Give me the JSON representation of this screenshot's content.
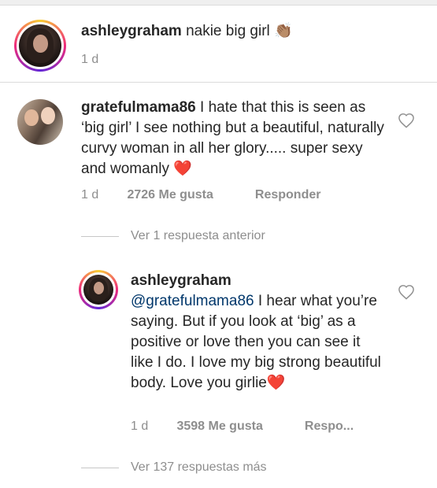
{
  "caption": {
    "username": "ashleygraham",
    "text": "nakie big girl",
    "emoji": "👏🏽",
    "time": "1 d"
  },
  "comment1": {
    "username": "gratefulmama86",
    "text": "I hate that this is seen as ‘big girl’ I see nothing but a beautiful, naturally curvy woman in all her glory..... super sexy and womanly",
    "emoji": "❤️",
    "time": "1 d",
    "likes": "2726 Me gusta",
    "reply": "Responder"
  },
  "view_prev": "Ver 1 respuesta anterior",
  "reply1": {
    "username": "ashleygraham",
    "mention": "@gratefulmama86",
    "text": " I hear what you’re saying. But if you look at ‘big’ as a positive or love then you can see it like I do. I love my big strong beautiful body. Love you girlie",
    "emoji": "❤️",
    "time": "1 d",
    "likes": "3598 Me gusta",
    "reply": "Respo..."
  },
  "view_more": "Ver 137 respuestas más",
  "icons": {
    "like": "heart-outline-icon",
    "avatar_border": "story-ring"
  },
  "colors": {
    "text": "#262626",
    "meta": "#8e8e8e",
    "mention": "#00376b",
    "heart_emoji": "#e0245e"
  }
}
